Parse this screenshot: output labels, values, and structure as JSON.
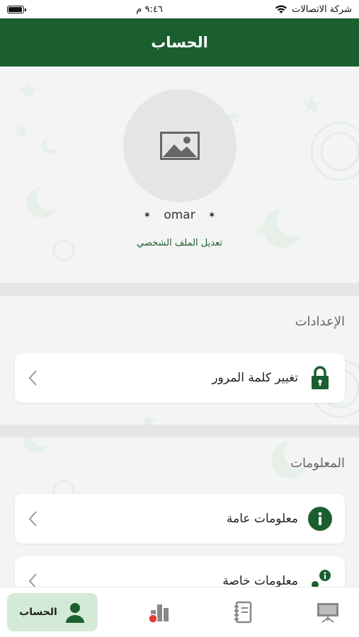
{
  "status_bar": {
    "carrier": "شركة الاتصالات",
    "time": "٩:٤٦ م",
    "battery_level": 1.0
  },
  "header": {
    "title": "الحساب"
  },
  "profile": {
    "avatar_icon": "image-placeholder-icon",
    "username": "omar",
    "star_left": "✶",
    "star_right": "✶",
    "edit_profile_label": "تعديل الملف الشخصي"
  },
  "settings_section": {
    "title": "الإعدادات",
    "items": [
      {
        "label": "تغيير كلمة المرور",
        "icon": "lock-icon"
      }
    ]
  },
  "info_section": {
    "title": "المعلومات",
    "items": [
      {
        "label": "معلومات عامة",
        "icon": "info-icon"
      },
      {
        "label": "معلومات خاصة",
        "icon": "person-info-icon"
      }
    ]
  },
  "tab_bar": {
    "tabs": [
      {
        "label": "الحساب",
        "icon": "user-icon",
        "active": true
      },
      {
        "label": "",
        "icon": "chart-icon",
        "active": false
      },
      {
        "label": "",
        "icon": "notebook-icon",
        "active": false
      },
      {
        "label": "",
        "icon": "presentation-board-icon",
        "active": false
      }
    ]
  },
  "colors": {
    "brand_green": "#1b5e30",
    "active_tab_bg": "#d3ead6",
    "notification_dot": "#e53935"
  }
}
